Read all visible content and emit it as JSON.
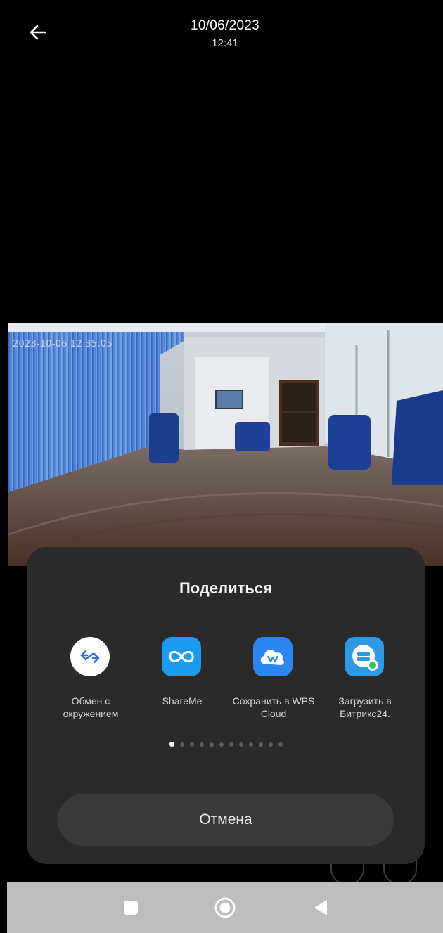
{
  "header": {
    "date": "10/06/2023",
    "time": "12:41",
    "back_icon": "arrow-left-icon"
  },
  "photo": {
    "timestamp": "2023-10-06 12:35:05"
  },
  "share_sheet": {
    "title": "Поделиться",
    "apps": [
      {
        "label": "Обмен с окружением",
        "icon": "nearby-share-icon"
      },
      {
        "label": "ShareMe",
        "icon": "shareme-icon"
      },
      {
        "label": "Сохранить в WPS Cloud",
        "icon": "wps-cloud-icon"
      },
      {
        "label": "Загрузить в Битрикс24.",
        "icon": "bitrix24-icon"
      }
    ],
    "page_count": 12,
    "current_page": 1,
    "cancel_label": "Отмена"
  },
  "navbar": {
    "icons": [
      "recents-square-icon",
      "home-circle-icon",
      "back-triangle-icon"
    ]
  },
  "colors": {
    "sheet_bg": "#2a2a2a",
    "cancel_bg": "#3a3a3a",
    "navbar_bg": "#bdbdbd",
    "shareme_blue": "#1a9bf0",
    "wps_blue": "#2b86f0",
    "bitrix_blue": "#2d9ae6"
  }
}
